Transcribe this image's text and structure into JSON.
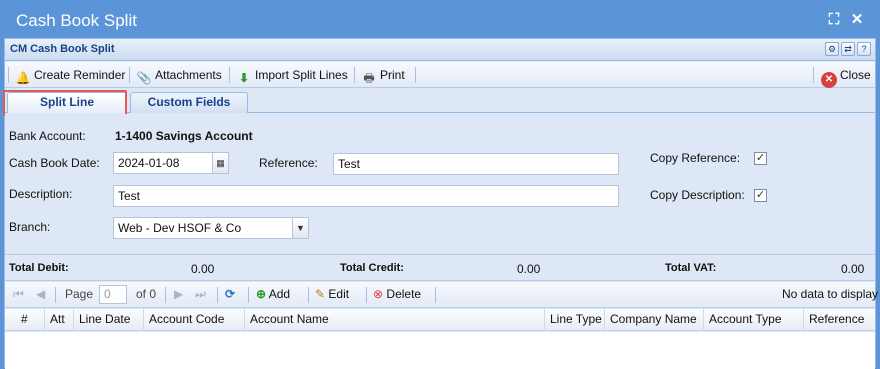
{
  "window": {
    "title": "Cash Book Split"
  },
  "panel": {
    "title": "CM Cash Book Split"
  },
  "toolbar": {
    "create_reminder": "Create Reminder",
    "attachments": "Attachments",
    "import_split_lines": "Import Split Lines",
    "print": "Print",
    "close": "Close"
  },
  "tabs": [
    {
      "label": "Split Line",
      "active": true
    },
    {
      "label": "Custom Fields",
      "active": false
    }
  ],
  "form": {
    "bank_account_label": "Bank Account:",
    "bank_account_value": "1-1400 Savings Account",
    "cash_book_date_label": "Cash Book Date:",
    "cash_book_date_value": "2024-01-08",
    "reference_label": "Reference:",
    "reference_value": "Test",
    "copy_reference_label": "Copy Reference:",
    "copy_reference_checked": true,
    "description_label": "Description:",
    "description_value": "Test",
    "copy_description_label": "Copy Description:",
    "copy_description_checked": true,
    "branch_label": "Branch:",
    "branch_value": "Web - Dev HSOF & Co"
  },
  "totals": {
    "debit_label": "Total Debit:",
    "debit_value": "0.00",
    "credit_label": "Total Credit:",
    "credit_value": "0.00",
    "vat_label": "Total VAT:",
    "vat_value": "0.00"
  },
  "pager": {
    "page_label": "Page",
    "page_value": "0",
    "of_label": "of 0",
    "add": "Add",
    "edit": "Edit",
    "delete": "Delete",
    "status": "No data to display"
  },
  "grid": {
    "columns": [
      "#",
      "Att",
      "Line Date",
      "Account Code",
      "Account Name",
      "Line Type",
      "Company Name",
      "Account Type",
      "Reference"
    ]
  },
  "colors": {
    "title_bar": "#5b95d8",
    "panel": "#dde7f5",
    "highlight": "#e05a5a"
  }
}
